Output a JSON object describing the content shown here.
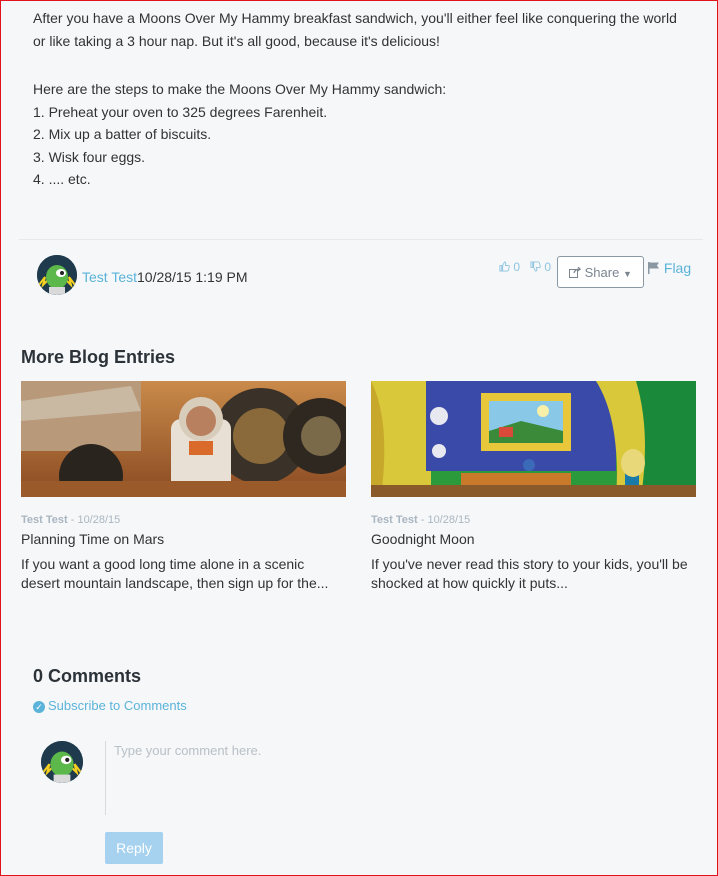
{
  "post": {
    "paragraph1": "After you have a Moons Over My Hammy breakfast sandwich, you'll either feel like conquering the world or like taking a 3 hour nap. But it's all good, because it's delicious!",
    "steps_intro": "Here are the steps to make the Moons Over My Hammy sandwich:",
    "steps": [
      "1. Preheat your oven to 325 degrees Farenheit.",
      "2. Mix up a batter of biscuits.",
      "3. Wisk four eggs.",
      "4. .... etc."
    ]
  },
  "author": {
    "name": "Test Test",
    "datetime": "10/28/15 1:19 PM"
  },
  "actions": {
    "likes": "0",
    "dislikes": "0",
    "share_label": "Share",
    "flag_label": "Flag",
    "icons": [
      "thumbs-up-icon",
      "thumbs-down-icon",
      "share-icon",
      "caret-down-icon",
      "flag-icon"
    ]
  },
  "more_entries": {
    "title": "More Blog Entries",
    "entries": [
      {
        "author": "Test Test",
        "date": " - 10/28/15",
        "title": "Planning Time on Mars",
        "excerpt": "If you want a good long time alone in a scenic desert mountain landscape, then sign up for the..."
      },
      {
        "author": "Test Test",
        "date": " - 10/28/15",
        "title": "Goodnight Moon",
        "excerpt": "If you've never read this story to your kids, you'll be shocked at how quickly it puts..."
      }
    ]
  },
  "comments": {
    "title": "0 Comments",
    "subscribe_label": "Subscribe to Comments",
    "placeholder": "Type your comment here.",
    "reply_label": "Reply"
  },
  "colors": {
    "link": "#5bb3d9",
    "background": "#f5f7f9",
    "reply_button": "#a6d2f0"
  }
}
